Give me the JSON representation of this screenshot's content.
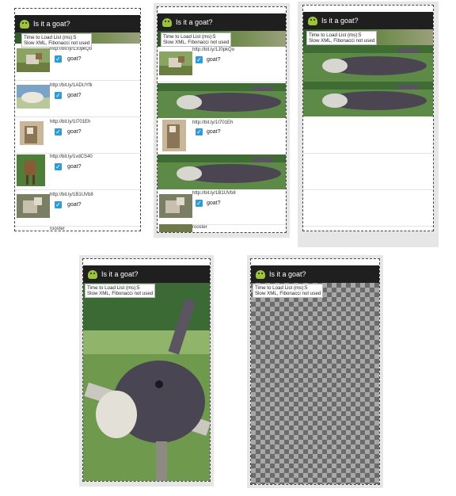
{
  "app": {
    "title": "Is it a goat?"
  },
  "timing": {
    "line1": "Time to Load List (ms):5",
    "line1_alt": "Time to Load List (ms):5",
    "line2": "Slow XML, Fibonacci not used"
  },
  "rows": [
    {
      "url": "http://bit.ly/1J0pkQo",
      "label": "goat?"
    },
    {
      "url": "http://bit.ly/1ADUYfk",
      "label": "goat?"
    },
    {
      "url": "http://bit.ly/1t701Eh",
      "label": "goat?"
    },
    {
      "url": "http://bit.ly/1vdCS40",
      "label": "goat?"
    },
    {
      "url": "http://bit.ly/1B1UVb8",
      "label": "goat?"
    },
    {
      "url": "rooster",
      "label": ""
    }
  ],
  "colors": {
    "appbar": "#1f1f1f",
    "checkbox": "#2e9bd7",
    "android": "#9bc33b"
  },
  "icons": {
    "app": "android-icon",
    "check": "check-icon"
  }
}
